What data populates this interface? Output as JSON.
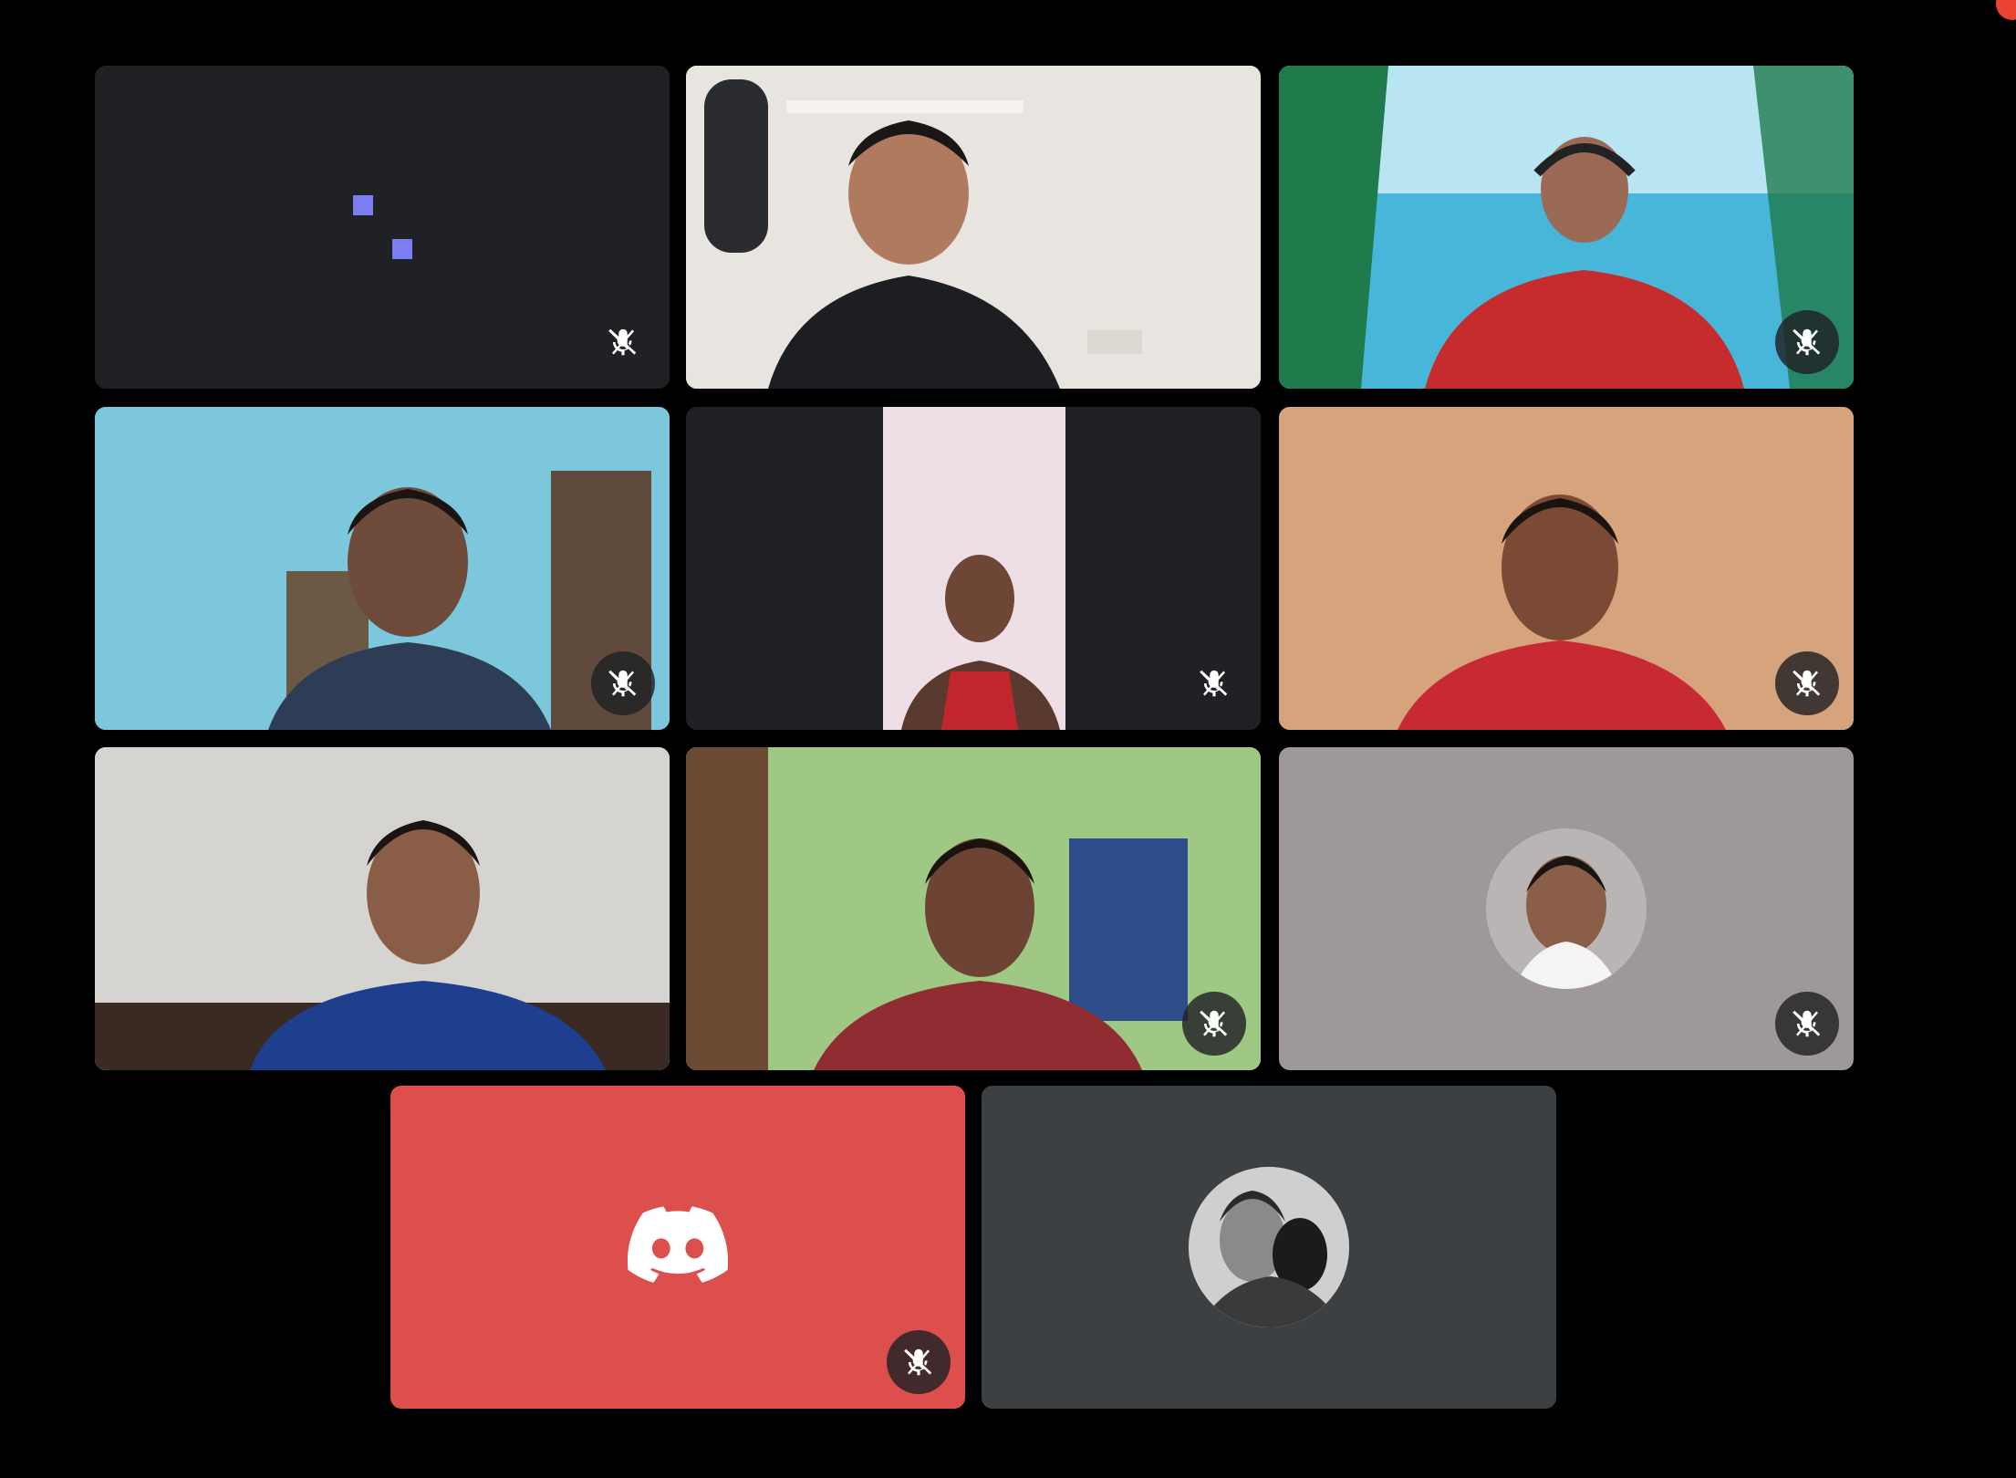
{
  "meeting": {
    "tiles": [
      {
        "id": "loading",
        "muted": true,
        "bg": "#202124"
      },
      {
        "id": "host-speaking",
        "muted": false,
        "speaking": true,
        "bg": "#e9e7e2",
        "highlight": "#6fb36a"
      },
      {
        "id": "beach-background",
        "muted": true,
        "bg": "#7fc6e6"
      },
      {
        "id": "blue-room",
        "muted": true,
        "bg": "#8fd0e0"
      },
      {
        "id": "portrait-camera",
        "muted": true,
        "bg": "#202124"
      },
      {
        "id": "orange-room",
        "muted": true,
        "bg": "#d9a77f"
      },
      {
        "id": "grey-room",
        "muted": true,
        "bg": "#c8c8c6"
      },
      {
        "id": "green-room",
        "muted": true,
        "bg": "#a9c98a"
      },
      {
        "id": "avatar-grey",
        "muted": true,
        "bg": "#9e9898",
        "avatar": true
      },
      {
        "id": "discord-user",
        "muted": true,
        "bg": "#dd4f4c",
        "icon": "discord-icon"
      },
      {
        "id": "avatar-dark",
        "muted": false,
        "bg": "#3c4043",
        "avatar": true
      }
    ],
    "icons": {
      "mute": "mic-off-icon",
      "discord": "discord-icon",
      "loading": "loading-dots-icon"
    },
    "colors": {
      "tile_dark": "#202124",
      "speaking_border": "#6fb36a",
      "discord_red": "#dd4f4c",
      "loading_dots": "#7b7ef0",
      "notification": "#ea4335"
    }
  }
}
